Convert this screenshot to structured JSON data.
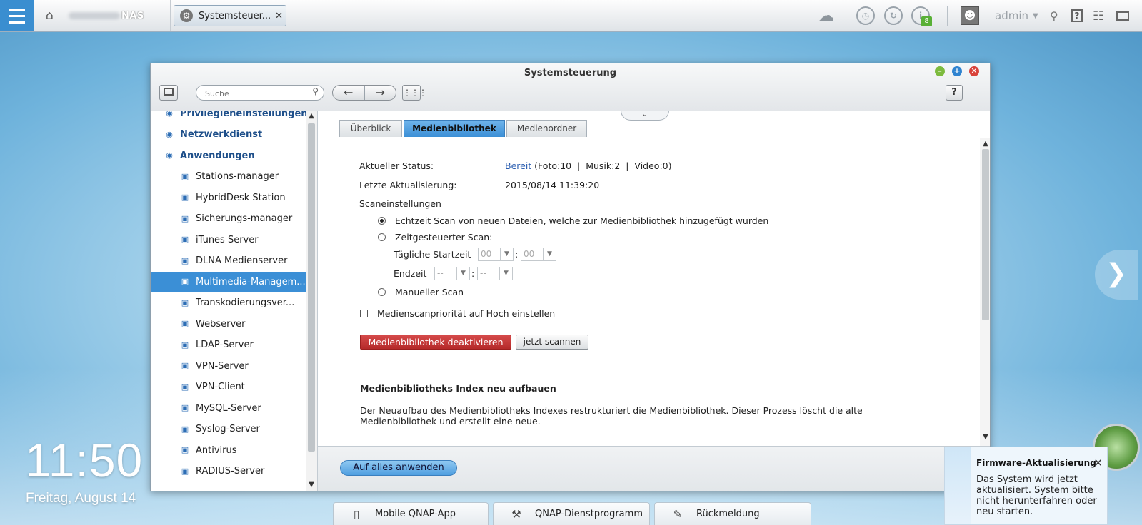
{
  "taskbar": {
    "brand": "NAS",
    "open_tab": "Systemsteuer...",
    "notification_count": "8",
    "user": "admin"
  },
  "desktop": {
    "time": "11:50",
    "date": "Freitag, August 14"
  },
  "window": {
    "title": "Systemsteuerung",
    "search_placeholder": "Suche",
    "help": "?"
  },
  "sidebar": {
    "items": [
      {
        "label": "Privilegieneinstellungen",
        "type": "category",
        "icon": "user-group-icon"
      },
      {
        "label": "Netzwerkdienst",
        "type": "category",
        "icon": "globe-icon"
      },
      {
        "label": "Anwendungen",
        "type": "category",
        "icon": "tray-icon"
      },
      {
        "label": "Stations-manager",
        "type": "item",
        "icon": "stations-icon"
      },
      {
        "label": "HybridDesk Station",
        "type": "item",
        "icon": "hd-icon"
      },
      {
        "label": "Sicherungs-manager",
        "type": "item",
        "icon": "backup-icon"
      },
      {
        "label": "iTunes Server",
        "type": "item",
        "icon": "itunes-icon"
      },
      {
        "label": "DLNA Medienserver",
        "type": "item",
        "icon": "dlna-icon"
      },
      {
        "label": "Multimedia-Managem...",
        "type": "item",
        "icon": "multimedia-icon",
        "selected": true
      },
      {
        "label": "Transkodierungsver...",
        "type": "item",
        "icon": "transcode-icon"
      },
      {
        "label": "Webserver",
        "type": "item",
        "icon": "web-globe-icon"
      },
      {
        "label": "LDAP-Server",
        "type": "item",
        "icon": "ldap-icon"
      },
      {
        "label": "VPN-Server",
        "type": "item",
        "icon": "vpn-server-icon"
      },
      {
        "label": "VPN-Client",
        "type": "item",
        "icon": "vpn-client-icon"
      },
      {
        "label": "MySQL-Server",
        "type": "item",
        "icon": "mysql-icon"
      },
      {
        "label": "Syslog-Server",
        "type": "item",
        "icon": "syslog-icon"
      },
      {
        "label": "Antivirus",
        "type": "item",
        "icon": "antivirus-icon"
      },
      {
        "label": "RADIUS-Server",
        "type": "item",
        "icon": "radius-icon"
      }
    ]
  },
  "tabs": [
    "Überblick",
    "Medienbibliothek",
    "Medienordner"
  ],
  "active_tab": "Medienbibliothek",
  "status": {
    "label": "Aktueller Status:",
    "value_link": "Bereit",
    "value_rest": " (Foto:10  |  Musik:2  |  Video:0)"
  },
  "last_update": {
    "label": "Letzte Aktualisierung:",
    "value": "2015/08/14 11:39:20"
  },
  "scan": {
    "heading": "Scaneinstellungen",
    "realtime": "Echtzeit Scan von neuen Dateien, welche zur Medienbibliothek hinzugefügt wurden",
    "scheduled": "Zeitgesteuerter Scan:",
    "start_label": "Tägliche Startzeit",
    "start_hour": "00",
    "start_min": "00",
    "end_label": "Endzeit",
    "end_hour": "--",
    "end_min": "--",
    "manual": "Manueller Scan",
    "selected": "realtime",
    "priority": "Medienscanpriorität auf Hoch einstellen",
    "priority_checked": false
  },
  "buttons": {
    "deactivate": "Medienbibliothek deaktivieren",
    "scan_now": "jetzt scannen",
    "apply_all": "Auf alles anwenden"
  },
  "rebuild": {
    "title": "Medienbibliotheks Index neu aufbauen",
    "line1": "Der Neuaufbau des Medienbibliotheks Indexes restrukturiert die Medienbibliothek. Dieser Prozess löscht die alte",
    "line2": "Medienbibliothek und erstellt eine neue."
  },
  "notification": {
    "title": "Firmware-Aktualisierung",
    "body": "Das System wird jetzt aktualisiert. System bitte nicht herunterfahren oder neu starten."
  },
  "dock": [
    "Mobile QNAP-App",
    "QNAP-Dienstprogramm",
    "Rückmeldung"
  ],
  "colors": {
    "accent": "#3b8fd6",
    "danger": "#c03535",
    "ok": "#58b036",
    "link": "#2a5db0"
  }
}
